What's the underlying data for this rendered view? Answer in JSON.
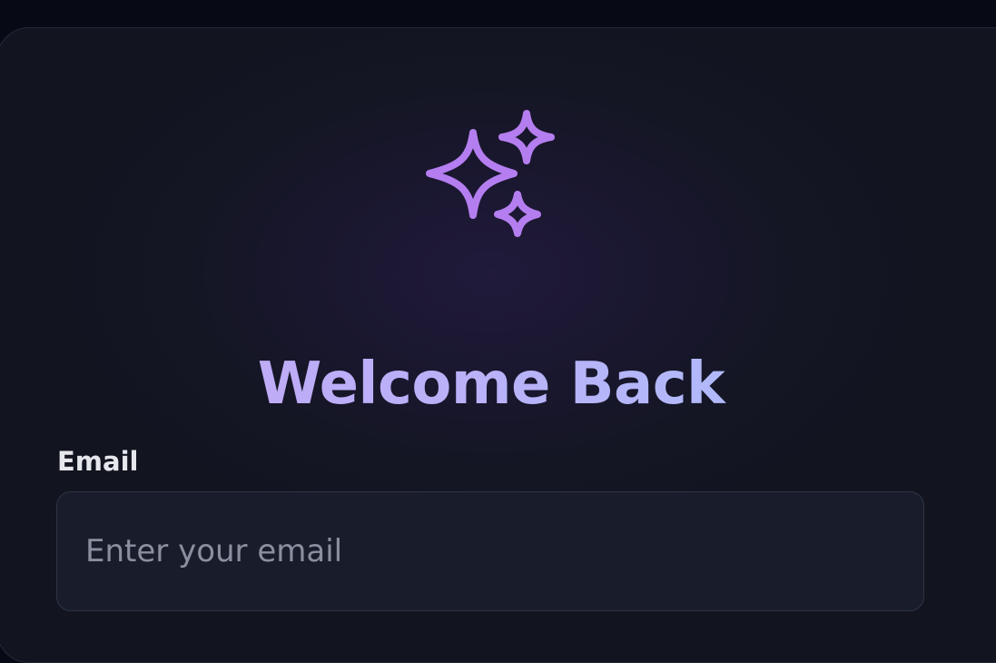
{
  "login": {
    "title": "Welcome Back",
    "logo_icon": "sparkles-icon",
    "email": {
      "label": "Email",
      "value": "",
      "placeholder": "Enter your email"
    }
  },
  "colors": {
    "page_background": "#070914",
    "card_background": "#141624",
    "accent_purple": "#b57ef0",
    "title_gradient_start": "#c4a4f6",
    "title_gradient_end": "#a8c1fb",
    "label_text": "#e5e7ec",
    "placeholder_text": "#8a90a0",
    "input_background": "#191d2b",
    "input_border": "#2e3446"
  }
}
